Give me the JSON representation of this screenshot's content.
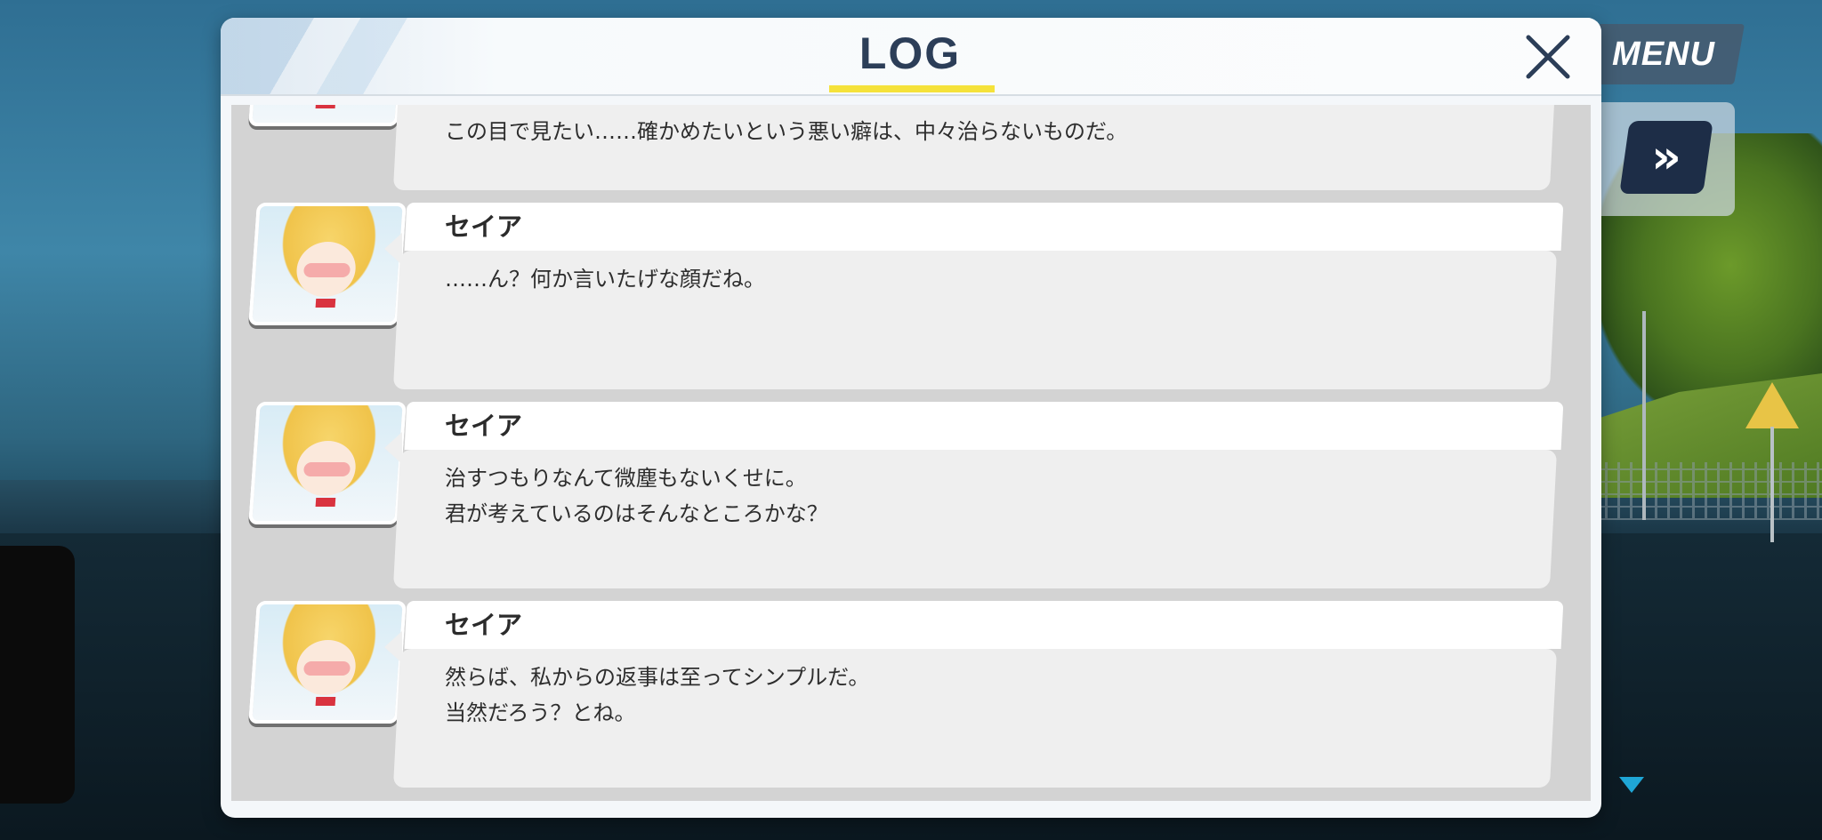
{
  "hud": {
    "menu_label": "MENU",
    "fast_forward_glyph": "»",
    "menu_icon": "menu-button",
    "fast_forward_icon": "fast-forward-icon",
    "advance_icon": "down-triangle-icon"
  },
  "log": {
    "title": "LOG",
    "close_icon": "close-icon",
    "accent_color": "#f5e23a",
    "entries": [
      {
        "speaker": "",
        "lines": [
          "この目で見たい……確かめたいという悪い癖は、中々治らないものだ。"
        ]
      },
      {
        "speaker": "セイア",
        "lines": [
          "……ん？何か言いたげな顔だね。"
        ]
      },
      {
        "speaker": "セイア",
        "lines": [
          "治すつもりなんて微塵もないくせに。",
          "君が考えているのはそんなところかな？"
        ]
      },
      {
        "speaker": "セイア",
        "lines": [
          "然らば、私からの返事は至ってシンプルだ。",
          "当然だろう？とね。"
        ]
      }
    ]
  }
}
